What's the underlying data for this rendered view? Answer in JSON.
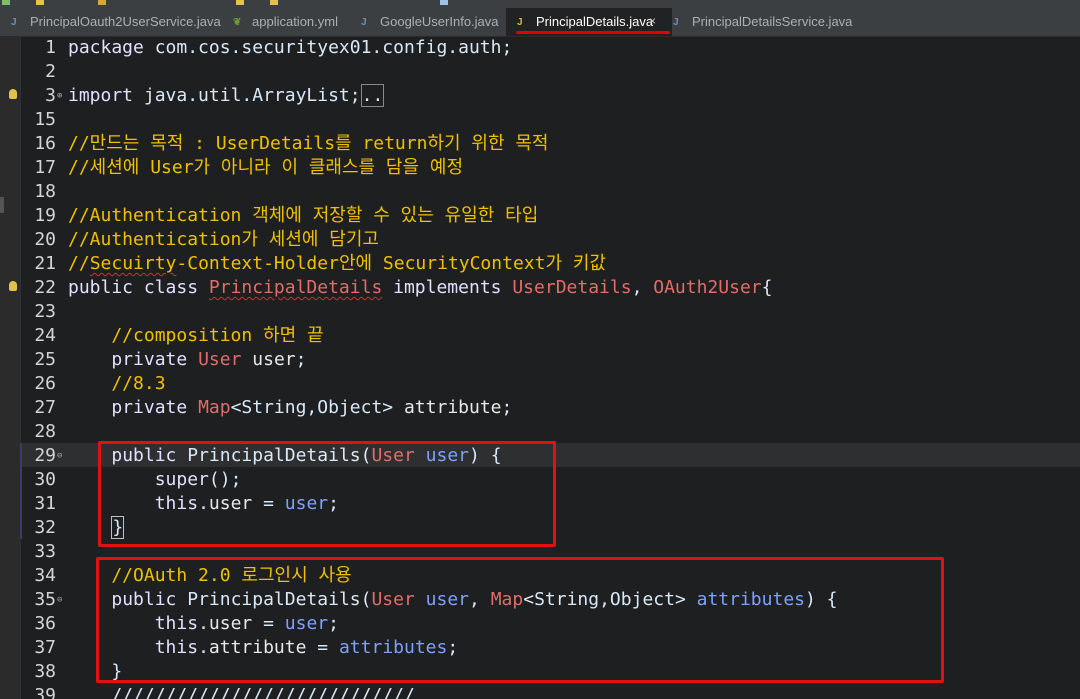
{
  "tabs": [
    {
      "label": "PrincipalOauth2UserService.java",
      "icon": "java-file-icon",
      "active": false
    },
    {
      "label": "application.yml",
      "icon": "yaml-file-icon",
      "active": false
    },
    {
      "label": "GoogleUserInfo.java",
      "icon": "java-file-icon",
      "active": false
    },
    {
      "label": "PrincipalDetails.java",
      "icon": "java-file-warning-icon",
      "active": true,
      "close_icon": "×"
    },
    {
      "label": "PrincipalDetailsService.java",
      "icon": "java-file-icon",
      "active": false
    }
  ],
  "editor": {
    "lines": [
      {
        "num": "1",
        "text": "package com.cos.securityex01.config.auth;"
      },
      {
        "num": "2",
        "text": ""
      },
      {
        "num": "3",
        "text": "import java.util.ArrayList;…",
        "folded": true,
        "warning": true
      },
      {
        "num": "15",
        "text": ""
      },
      {
        "num": "16",
        "text": "//만드는 목적 : UserDetails를 return하기 위한 목적"
      },
      {
        "num": "17",
        "text": "//세션에 User가 아니라 이 클래스를 담을 예정"
      },
      {
        "num": "18",
        "text": ""
      },
      {
        "num": "19",
        "text": "//Authentication 객체에 저장할 수 있는 유일한 타입"
      },
      {
        "num": "20",
        "text": "//Authentication가 세션에 담기고"
      },
      {
        "num": "21",
        "text": "//Secuirty-Context-Holder안에 SecurityContext가 키값"
      },
      {
        "num": "22",
        "text": "public class PrincipalDetails implements UserDetails, OAuth2User{",
        "warning": true
      },
      {
        "num": "23",
        "text": ""
      },
      {
        "num": "24",
        "text": "    //composition 하면 끝"
      },
      {
        "num": "25",
        "text": "    private User user;"
      },
      {
        "num": "26",
        "text": "    //8.3"
      },
      {
        "num": "27",
        "text": "    private Map<String,Object> attribute;"
      },
      {
        "num": "28",
        "text": ""
      },
      {
        "num": "29",
        "text": "    public PrincipalDetails(User user) {",
        "fold": true,
        "current": true
      },
      {
        "num": "30",
        "text": "        super();"
      },
      {
        "num": "31",
        "text": "        this.user = user;"
      },
      {
        "num": "32",
        "text": "    }"
      },
      {
        "num": "33",
        "text": ""
      },
      {
        "num": "34",
        "text": "    //OAuth 2.0 로그인시 사용"
      },
      {
        "num": "35",
        "text": "    public PrincipalDetails(User user, Map<String,Object> attributes) {",
        "fold": true
      },
      {
        "num": "36",
        "text": "        this.user = user;"
      },
      {
        "num": "37",
        "text": "        this.attribute = attributes;"
      },
      {
        "num": "38",
        "text": "    }"
      },
      {
        "num": "39",
        "text": "    ////////////////////////////"
      }
    ]
  },
  "icons": {
    "fold_marker": "⊖",
    "warning": "lightbulb-warning-icon"
  },
  "colors": {
    "annotation": "#e21111",
    "comment": "#f0c000",
    "type": "#e26d68",
    "param": "#7ea1ff"
  }
}
